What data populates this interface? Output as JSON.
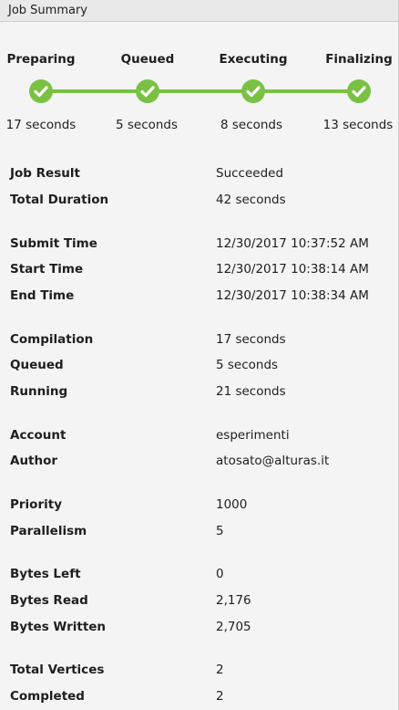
{
  "panel": {
    "title": "Job Summary"
  },
  "stages": [
    {
      "label": "Preparing",
      "duration": "17 seconds",
      "status": "complete"
    },
    {
      "label": "Queued",
      "duration": "5 seconds",
      "status": "complete"
    },
    {
      "label": "Executing",
      "duration": "8 seconds",
      "status": "complete"
    },
    {
      "label": "Finalizing",
      "duration": "13 seconds",
      "status": "complete"
    }
  ],
  "colors": {
    "progress": "#7ac143",
    "header_bg": "#e9e9e9",
    "page_bg": "#f4f4f4"
  },
  "icons": {
    "stage_complete": "checkmark-icon"
  },
  "summary": [
    {
      "label": "Job Result",
      "value": "Succeeded"
    },
    {
      "label": "Total Duration",
      "value": "42 seconds"
    },
    {
      "label": "Submit Time",
      "value": "12/30/2017 10:37:52 AM"
    },
    {
      "label": "Start Time",
      "value": "12/30/2017 10:38:14 AM"
    },
    {
      "label": "End Time",
      "value": "12/30/2017 10:38:34 AM"
    },
    {
      "label": "Compilation",
      "value": "17 seconds"
    },
    {
      "label": "Queued",
      "value": "5 seconds"
    },
    {
      "label": "Running",
      "value": "21 seconds"
    },
    {
      "label": "Account",
      "value": "esperimenti"
    },
    {
      "label": "Author",
      "value": "atosato@alturas.it"
    },
    {
      "label": "Priority",
      "value": "1000"
    },
    {
      "label": "Parallelism",
      "value": "5"
    },
    {
      "label": "Bytes Left",
      "value": "0"
    },
    {
      "label": "Bytes Read",
      "value": "2,176"
    },
    {
      "label": "Bytes Written",
      "value": "2,705"
    },
    {
      "label": "Total Vertices",
      "value": "2"
    },
    {
      "label": "Completed",
      "value": "2"
    }
  ]
}
